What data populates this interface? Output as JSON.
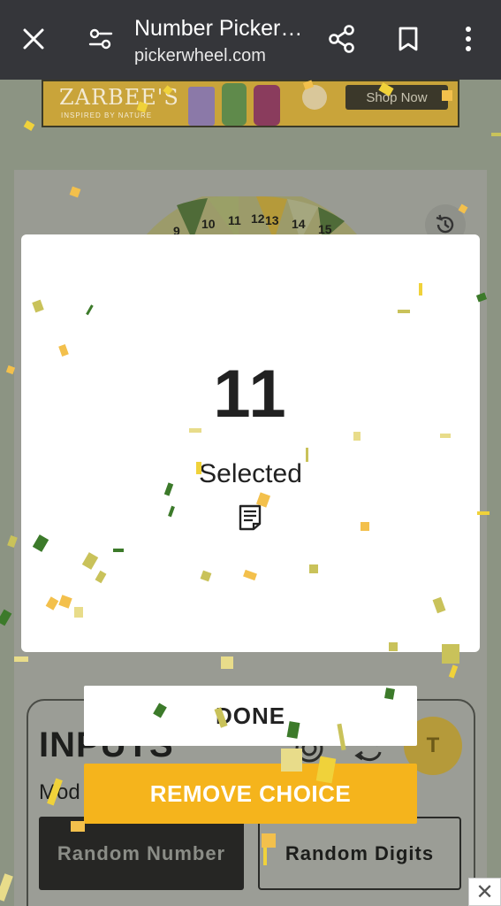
{
  "browser": {
    "title": "Number Picker…",
    "url": "pickerwheel.com",
    "icons": {
      "close": "close-icon",
      "tune": "tune-icon",
      "share": "share-icon",
      "bookmark": "bookmark-icon",
      "menu": "more-vert-icon"
    }
  },
  "ad": {
    "brand": "ZARBEE'S",
    "tagline": "INSPIRED BY NATURE",
    "cta": "Shop Now",
    "close_label": "✕"
  },
  "wheel": {
    "visible_numbers": [
      "9",
      "10",
      "11",
      "12",
      "13",
      "14",
      "15"
    ]
  },
  "modal": {
    "result": "11",
    "result_label": "Selected",
    "notes_icon": "notes-icon"
  },
  "actions": {
    "done_label": "DONE",
    "remove_label": "REMOVE CHOICE"
  },
  "inputs": {
    "title": "INPUTS",
    "mode_label": "Mod",
    "mode_options": [
      "Random Number",
      "Random Digits"
    ],
    "avatar_initial": "T"
  },
  "colors": {
    "accent": "#f5b41c",
    "topbar": "#35363a",
    "confetti": [
      "#f0d23a",
      "#c9c25a",
      "#3c7a2a",
      "#f3c04c",
      "#e8dc8a"
    ]
  }
}
